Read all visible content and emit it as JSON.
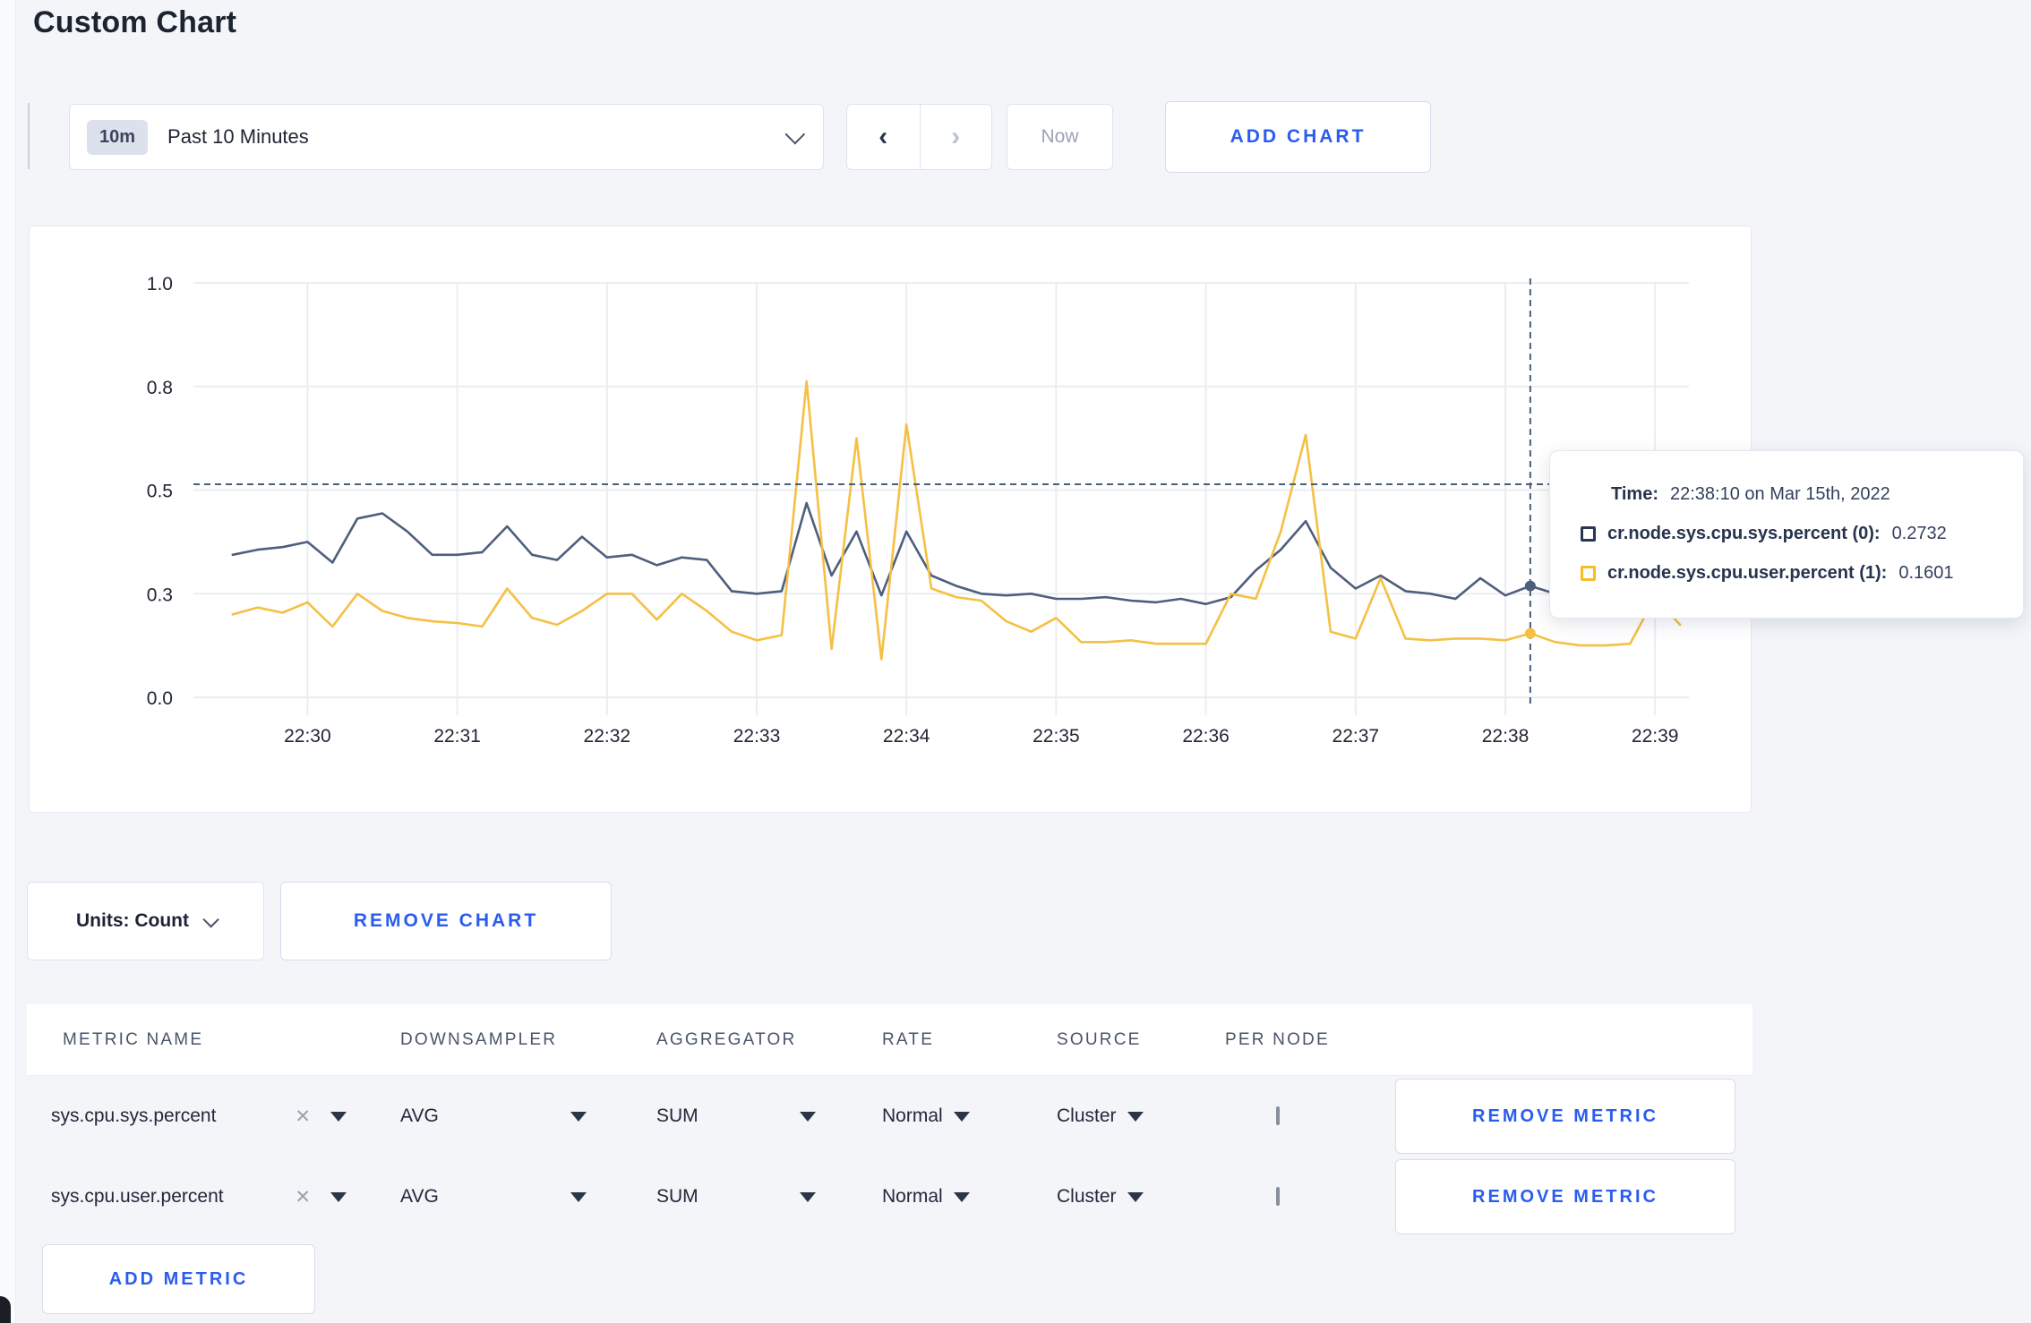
{
  "page": {
    "title": "Custom Chart"
  },
  "toolbar": {
    "time_range": {
      "badge": "10m",
      "label": "Past 10 Minutes"
    },
    "prev_arrow": "‹",
    "next_arrow": "›",
    "now_label": "Now",
    "add_chart_label": "ADD CHART"
  },
  "units": {
    "label": "Units: Count"
  },
  "actions": {
    "remove_chart": "REMOVE CHART",
    "remove_metric": "REMOVE METRIC",
    "add_metric": "ADD METRIC"
  },
  "tooltip": {
    "time_label": "Time:",
    "time_value": "22:38:10 on Mar 15th, 2022",
    "rows": [
      {
        "label": "cr.node.sys.cpu.sys.percent (0):",
        "value": "0.2732",
        "color": "#2a3752"
      },
      {
        "label": "cr.node.sys.cpu.user.percent (1):",
        "value": "0.1601",
        "color": "#f7bd27"
      }
    ]
  },
  "metrics_table": {
    "columns": [
      "METRIC NAME",
      "DOWNSAMPLER",
      "AGGREGATOR",
      "RATE",
      "SOURCE",
      "PER NODE"
    ],
    "clear_icon": "✕",
    "rows": [
      {
        "name": "sys.cpu.sys.percent",
        "downsampler": "AVG",
        "aggregator": "SUM",
        "rate": "Normal",
        "source": "Cluster",
        "per_node_checked": false
      },
      {
        "name": "sys.cpu.user.percent",
        "downsampler": "AVG",
        "aggregator": "SUM",
        "rate": "Normal",
        "source": "Cluster",
        "per_node_checked": false
      }
    ]
  },
  "chart_data": {
    "type": "line",
    "title": "",
    "xlabel": "",
    "ylabel": "",
    "grid": true,
    "legend_position": "tooltip-only",
    "y_ticks": [
      0.0,
      0.3,
      0.5,
      0.8,
      1.0
    ],
    "y_tick_labels": [
      "0.0",
      "0.3",
      "0.5",
      "0.8",
      "1.0"
    ],
    "x_ticks": [
      "22:30",
      "22:31",
      "22:32",
      "22:33",
      "22:34",
      "22:35",
      "22:36",
      "22:37",
      "22:38",
      "22:39"
    ],
    "x_start_offset_min": -0.5,
    "x_step_min": 0.166667,
    "series": [
      {
        "name": "cr.node.sys.cpu.sys.percent",
        "color": "#4e5e7d",
        "values": [
          0.375,
          0.385,
          0.39,
          0.4,
          0.36,
          0.445,
          0.455,
          0.42,
          0.375,
          0.375,
          0.38,
          0.43,
          0.375,
          0.365,
          0.41,
          0.37,
          0.375,
          0.355,
          0.37,
          0.365,
          0.305,
          0.3,
          0.305,
          0.475,
          0.335,
          0.42,
          0.295,
          0.42,
          0.335,
          0.315,
          0.3,
          0.295,
          0.3,
          0.285,
          0.285,
          0.29,
          0.28,
          0.275,
          0.285,
          0.27,
          0.29,
          0.345,
          0.385,
          0.44,
          0.35,
          0.31,
          0.335,
          0.305,
          0.3,
          0.285,
          0.33,
          0.295,
          0.315,
          0.3,
          0.3,
          0.295,
          0.3,
          0.3,
          0.305
        ]
      },
      {
        "name": "cr.node.sys.cpu.user.percent",
        "color": "#f5c043",
        "values": [
          0.24,
          0.26,
          0.245,
          0.275,
          0.205,
          0.3,
          0.25,
          0.23,
          0.22,
          0.215,
          0.205,
          0.31,
          0.23,
          0.21,
          0.25,
          0.3,
          0.3,
          0.225,
          0.3,
          0.25,
          0.19,
          0.165,
          0.18,
          0.81,
          0.14,
          0.65,
          0.11,
          0.69,
          0.31,
          0.29,
          0.28,
          0.22,
          0.19,
          0.23,
          0.16,
          0.16,
          0.165,
          0.155,
          0.155,
          0.155,
          0.3,
          0.285,
          0.42,
          0.66,
          0.19,
          0.17,
          0.33,
          0.17,
          0.165,
          0.17,
          0.17,
          0.165,
          0.185,
          0.16,
          0.15,
          0.15,
          0.155,
          0.29,
          0.21
        ]
      }
    ],
    "hover": {
      "index": 52,
      "crosshair_y_value": 0.517,
      "time": "22:38:10",
      "values": [
        0.2732,
        0.1601
      ]
    }
  }
}
